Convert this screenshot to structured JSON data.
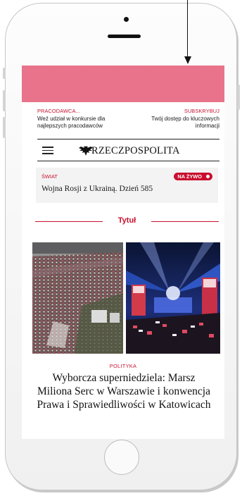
{
  "promo": {
    "left": {
      "tag": "PRACODAWCA...",
      "text": "Weź udział w konkursie dla najlepszych pracodawców"
    },
    "right": {
      "tag": "SUBSKRYBUJ",
      "text": "Twój dostęp do kluczowych informacji"
    }
  },
  "header": {
    "logo_text": "RZECZPOSPOLITA",
    "menu_icon": "hamburger-icon",
    "logo_icon": "eagle-icon"
  },
  "live": {
    "section": "ŚWIAT",
    "badge": "NA ŻYWO",
    "headline": "Wojna Rosji z Ukrainą. Dzień 585"
  },
  "section": {
    "title": "Tytuł"
  },
  "article": {
    "tag": "POLITYKA",
    "title": "Wyborcza superniedziela: Marsz Miliona Serc w Warszawie i konwencja Prawa i Sprawiedliwości w Katowicach"
  },
  "colors": {
    "accent": "#c8102e",
    "ad_banner": "#e9738a",
    "live_box_bg": "#f3f3f3"
  }
}
